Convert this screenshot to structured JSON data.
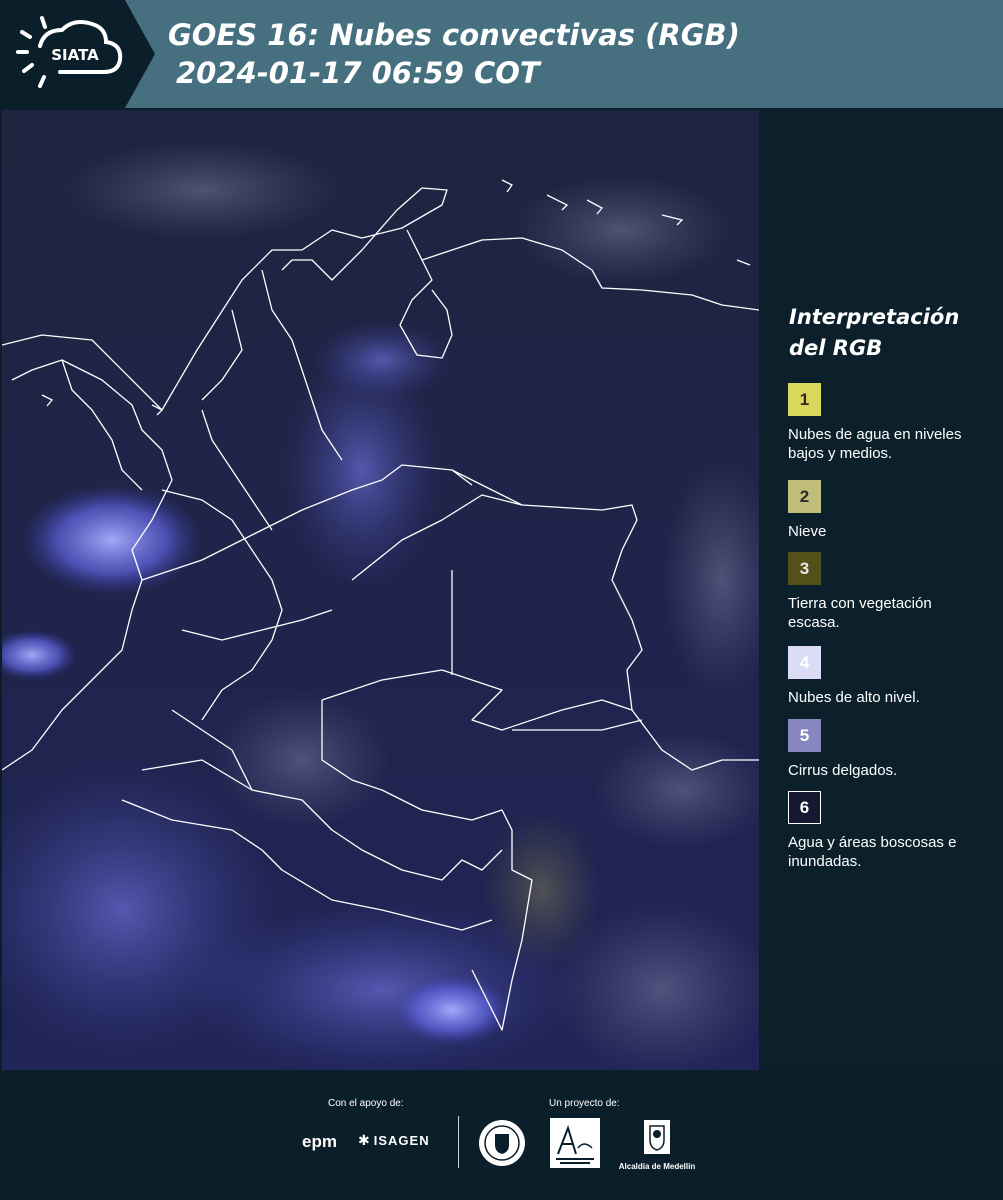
{
  "header": {
    "logo_text": "SIATA",
    "title_line1": "GOES 16: Nubes convectivas (RGB)",
    "title_line2": "2024-01-17 06:59 COT",
    "background_color": "#46707f"
  },
  "legend": {
    "title_line1": "Interpretación",
    "title_line2": "del RGB",
    "items": [
      {
        "number": "1",
        "label": "Nubes de agua en niveles bajos y medios.",
        "color": "#d9d85a"
      },
      {
        "number": "2",
        "label": "Nieve",
        "color": "#c1bd7b"
      },
      {
        "number": "3",
        "label": "Tierra con vegetación escasa.",
        "color": "#545019"
      },
      {
        "number": "4",
        "label": "Nubes de alto nivel.",
        "color": "#dcdcf7"
      },
      {
        "number": "5",
        "label": "Cirrus delgados.",
        "color": "#8687c2"
      },
      {
        "number": "6",
        "label": "Agua y áreas boscosas e inundadas.",
        "color": "#161832"
      }
    ]
  },
  "footer": {
    "support_label": "Con el apoyo de:",
    "project_label": "Un proyecto de:",
    "sponsors": [
      "epm",
      "ISAGEN"
    ],
    "partners": [
      "Área Metropolitana Valle de Aburrá",
      "Alcaldía de Medellín"
    ],
    "partner_caption": "Alcaldía de Medellín"
  }
}
